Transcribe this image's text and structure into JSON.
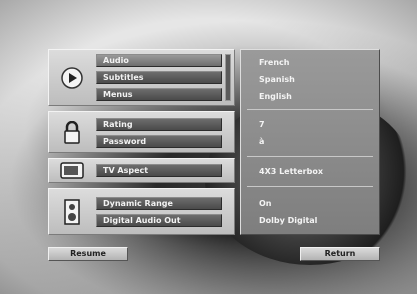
{
  "menu": {
    "groups": [
      {
        "icon": "audio-disc-icon",
        "items": [
          {
            "label": "Audio",
            "selected": true
          },
          {
            "label": "Subtitles"
          },
          {
            "label": "Menus"
          }
        ]
      },
      {
        "icon": "lock-icon",
        "items": [
          {
            "label": "Rating"
          },
          {
            "label": "Password"
          }
        ]
      },
      {
        "icon": "tv-icon",
        "items": [
          {
            "label": "TV Aspect"
          }
        ]
      },
      {
        "icon": "speaker-icon",
        "items": [
          {
            "label": "Dynamic Range"
          },
          {
            "label": "Digital Audio Out"
          }
        ]
      }
    ],
    "values": {
      "audio": "French",
      "subtitles": "Spanish",
      "menus": "English",
      "rating": "7",
      "password": "à",
      "tv_aspect": "4X3 Letterbox",
      "dynamic_range": "On",
      "digital_audio_out": "Dolby Digital"
    }
  },
  "buttons": {
    "resume": "Resume",
    "return": "Return"
  }
}
